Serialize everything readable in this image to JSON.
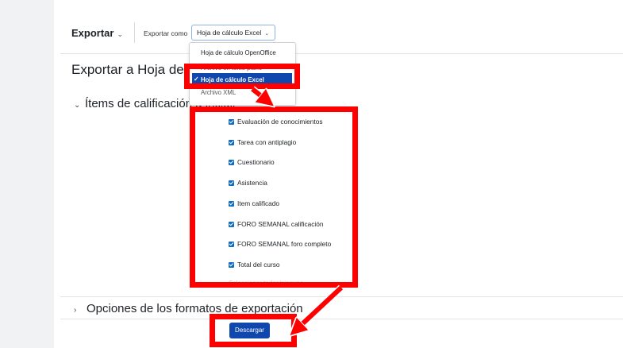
{
  "toolbar": {
    "title": "Exportar",
    "export_as_label": "Exportar como",
    "selected_format": "Hoja de cálculo Excel"
  },
  "page": {
    "heading": "Exportar a Hoja de cálculo Excel"
  },
  "dropdown": {
    "options": [
      "Hoja de cálculo OpenOffice",
      "Archivo en texto plano",
      "Hoja de cálculo Excel",
      "Archivo XML"
    ],
    "selected_index": 2
  },
  "items_section": {
    "title": "Ítems de calificación a incluir",
    "items": [
      {
        "label": "Evaluación de conocimientos",
        "checked": true
      },
      {
        "label": "Tarea con antiplagio",
        "checked": true
      },
      {
        "label": "Cuestionario",
        "checked": true
      },
      {
        "label": "Asistencia",
        "checked": true
      },
      {
        "label": "Item calificado",
        "checked": true
      },
      {
        "label": "FORO SEMANAL calificación",
        "checked": true
      },
      {
        "label": "FORO SEMANAL foro completo",
        "checked": true
      },
      {
        "label": "Total del curso",
        "checked": true
      }
    ],
    "partial_link": "Seleccionar todos/ninguno"
  },
  "format_options_section": {
    "title": "Opciones de los formatos de exportación"
  },
  "download_button": "Descargar",
  "colors": {
    "accent": "#0f47ad",
    "checkbox": "#0f6cbf",
    "annotation": "#ff0000"
  }
}
